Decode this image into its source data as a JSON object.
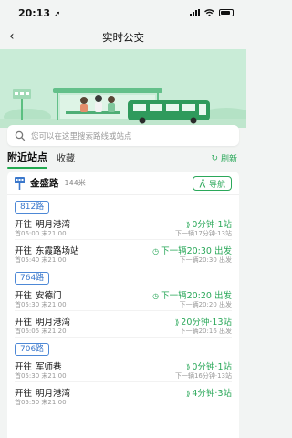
{
  "status_bar": {
    "time": "20:13",
    "arrow": "➚"
  },
  "nav": {
    "title": "实时公交",
    "back_symbol": "‹"
  },
  "search": {
    "placeholder": "您可以在这里搜索路线或站点"
  },
  "tabs": [
    {
      "label": "附近站点",
      "active": true
    },
    {
      "label": "收藏",
      "active": false
    }
  ],
  "refresh": {
    "label": "刷新",
    "symbol": "↻"
  },
  "stop": {
    "name": "金盛路",
    "distance": "144米",
    "nav_label": "导航"
  },
  "routes": [
    {
      "name": "812路",
      "directions": [
        {
          "prefix": "开往",
          "dest": "明月港湾",
          "times": "首06:00 末21:00",
          "arrival": "0分钟·1站",
          "next": "下一辆17分钟·13站"
        },
        {
          "prefix": "开往",
          "dest": "东霞路场站",
          "times": "首05:40 末21:00",
          "arrival": "下一辆20:30 出发",
          "next": "下一辆20:30 出发"
        }
      ]
    },
    {
      "name": "764路",
      "directions": [
        {
          "prefix": "开往",
          "dest": "安德门",
          "times": "首05:30 末21:00",
          "arrival": "下一辆20:20 出发",
          "next": "下一辆20:20 出发"
        },
        {
          "prefix": "开往",
          "dest": "明月港湾",
          "times": "首06:05 末21:20",
          "arrival": "20分钟·13站",
          "next": "下一辆20:16 出发"
        }
      ]
    },
    {
      "name": "706路",
      "directions": [
        {
          "prefix": "开往",
          "dest": "军师巷",
          "times": "首05:30 末21:00",
          "arrival": "0分钟·1站",
          "next": "下一辆16分钟·13站"
        },
        {
          "prefix": "开往",
          "dest": "明月港湾",
          "times": "首05:50 末21:00",
          "arrival": "4分钟·3站",
          "next": ""
        }
      ]
    }
  ],
  "colors": {
    "accent": "#2ba85a",
    "route_blue": "#3b78cc",
    "hero_bg": "#c9ecd7"
  }
}
